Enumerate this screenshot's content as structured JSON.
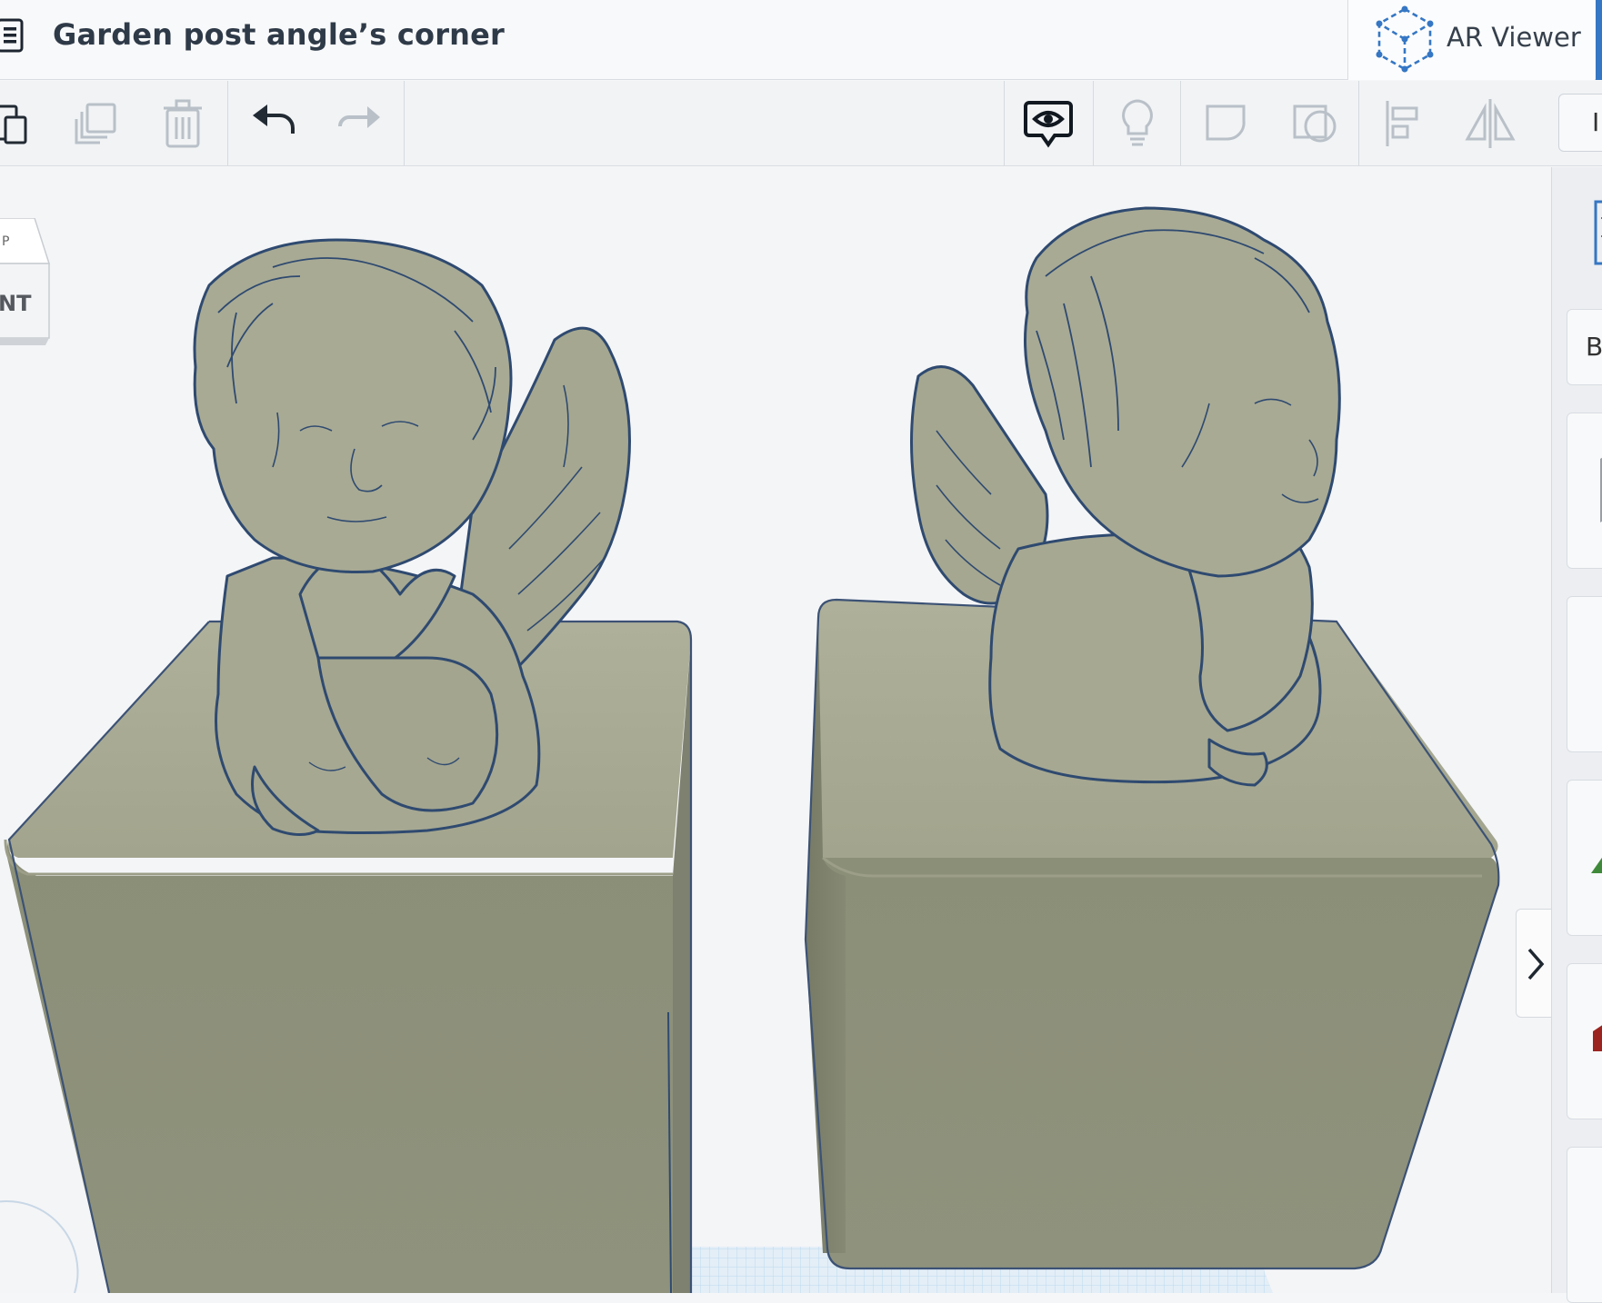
{
  "titlebar": {
    "menu_icon": "hamburger-menu-icon",
    "title": "Garden post angle’s corner",
    "ar_viewer": {
      "icon": "ar-cube-icon",
      "label": "AR Viewer",
      "accent": "#3577c4"
    }
  },
  "toolbar": {
    "edit_tools": [
      {
        "name": "paste",
        "icon": "paste-icon",
        "enabled": true
      },
      {
        "name": "duplicate",
        "icon": "duplicate-icon",
        "enabled": false
      },
      {
        "name": "delete",
        "icon": "trash-icon",
        "enabled": false
      }
    ],
    "history_tools": [
      {
        "name": "undo",
        "icon": "undo-icon",
        "enabled": true
      },
      {
        "name": "redo",
        "icon": "redo-icon",
        "enabled": false
      }
    ],
    "view_tools": [
      {
        "name": "show-all",
        "icon": "eye-bubble-icon",
        "enabled": true
      },
      {
        "name": "notes",
        "icon": "lightbulb-icon",
        "enabled": false
      },
      {
        "name": "group",
        "icon": "group-icon",
        "enabled": false
      },
      {
        "name": "ungroup",
        "icon": "ungroup-icon",
        "enabled": false
      },
      {
        "name": "align",
        "icon": "align-icon",
        "enabled": false
      },
      {
        "name": "mirror",
        "icon": "mirror-icon",
        "enabled": false
      }
    ],
    "right_button_partial": "I"
  },
  "viewcube": {
    "top_label": "P",
    "front_label": "NT"
  },
  "right_panel": {
    "partial_label": "B",
    "collapse_icon": "chevron-right-icon"
  },
  "colors": {
    "shape_fill": "#8e917b",
    "shape_top": "#a9ab95",
    "shape_outline": "#2f4a70",
    "workplane_grid": "#bcd9ef",
    "enabled_icon": "#222a33",
    "disabled_icon": "#b9c0c8"
  }
}
